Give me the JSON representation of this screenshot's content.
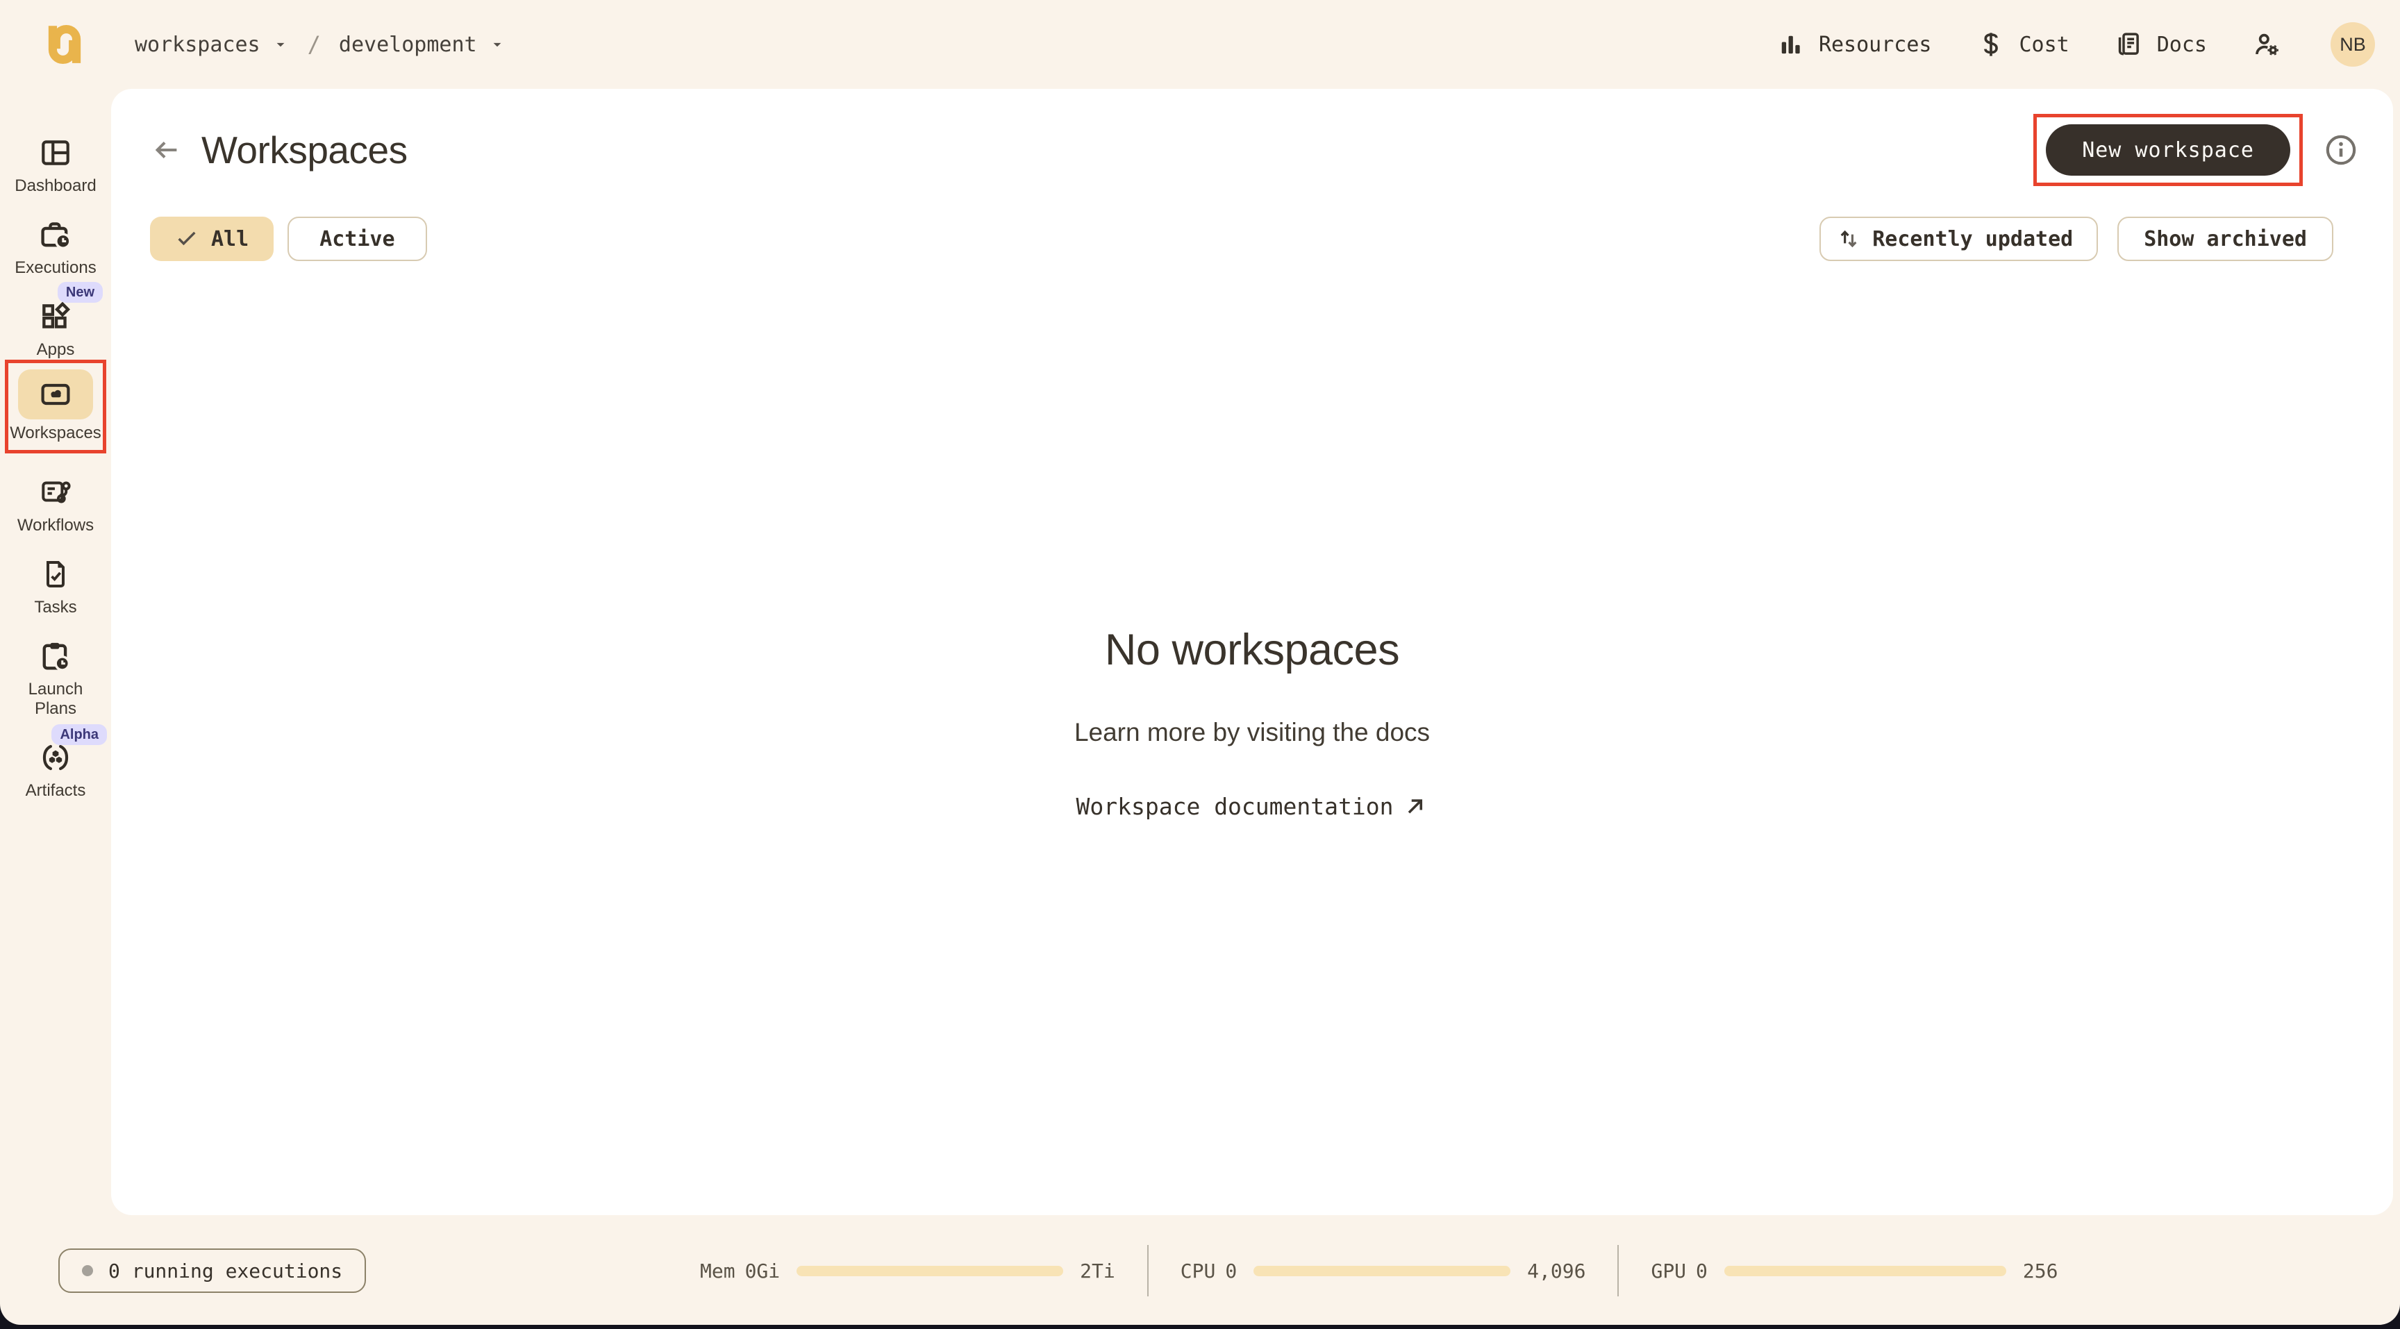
{
  "topbar": {
    "breadcrumb": {
      "project": "workspaces",
      "separator": "/",
      "domain": "development"
    },
    "nav": [
      {
        "label": "Resources"
      },
      {
        "label": "Cost"
      },
      {
        "label": "Docs"
      }
    ],
    "avatar_initials": "NB"
  },
  "sidebar": {
    "items": [
      {
        "label": "Dashboard"
      },
      {
        "label": "Executions"
      },
      {
        "label": "Apps",
        "badge": "New"
      },
      {
        "label": "Workspaces"
      },
      {
        "label": "Workflows"
      },
      {
        "label": "Tasks"
      },
      {
        "label": "Launch Plans"
      },
      {
        "label": "Artifacts",
        "badge": "Alpha"
      }
    ]
  },
  "page": {
    "title": "Workspaces",
    "new_workspace_button": "New workspace",
    "filters": {
      "all": "All",
      "active": "Active"
    },
    "sort_button": "Recently updated",
    "archived_button": "Show archived",
    "empty_state": {
      "title": "No workspaces",
      "subtitle": "Learn more by visiting the docs",
      "link": "Workspace documentation"
    }
  },
  "statusbar": {
    "executions_pill": "0 running executions",
    "meters": [
      {
        "label": "Mem",
        "value": "0Gi",
        "max": "2Ti"
      },
      {
        "label": "CPU",
        "value": "0",
        "max": "4,096"
      },
      {
        "label": "GPU",
        "value": "0",
        "max": "256"
      }
    ]
  },
  "colors": {
    "accent_amber": "#e9b44c",
    "active_item_bg": "#f3dcae",
    "annotation_red": "#e8432d",
    "primary_button_bg": "#37302a",
    "badge_bg": "#dedbfc",
    "meter_bar_fill": "#f8e3b5",
    "app_background": "#faf3ea"
  }
}
